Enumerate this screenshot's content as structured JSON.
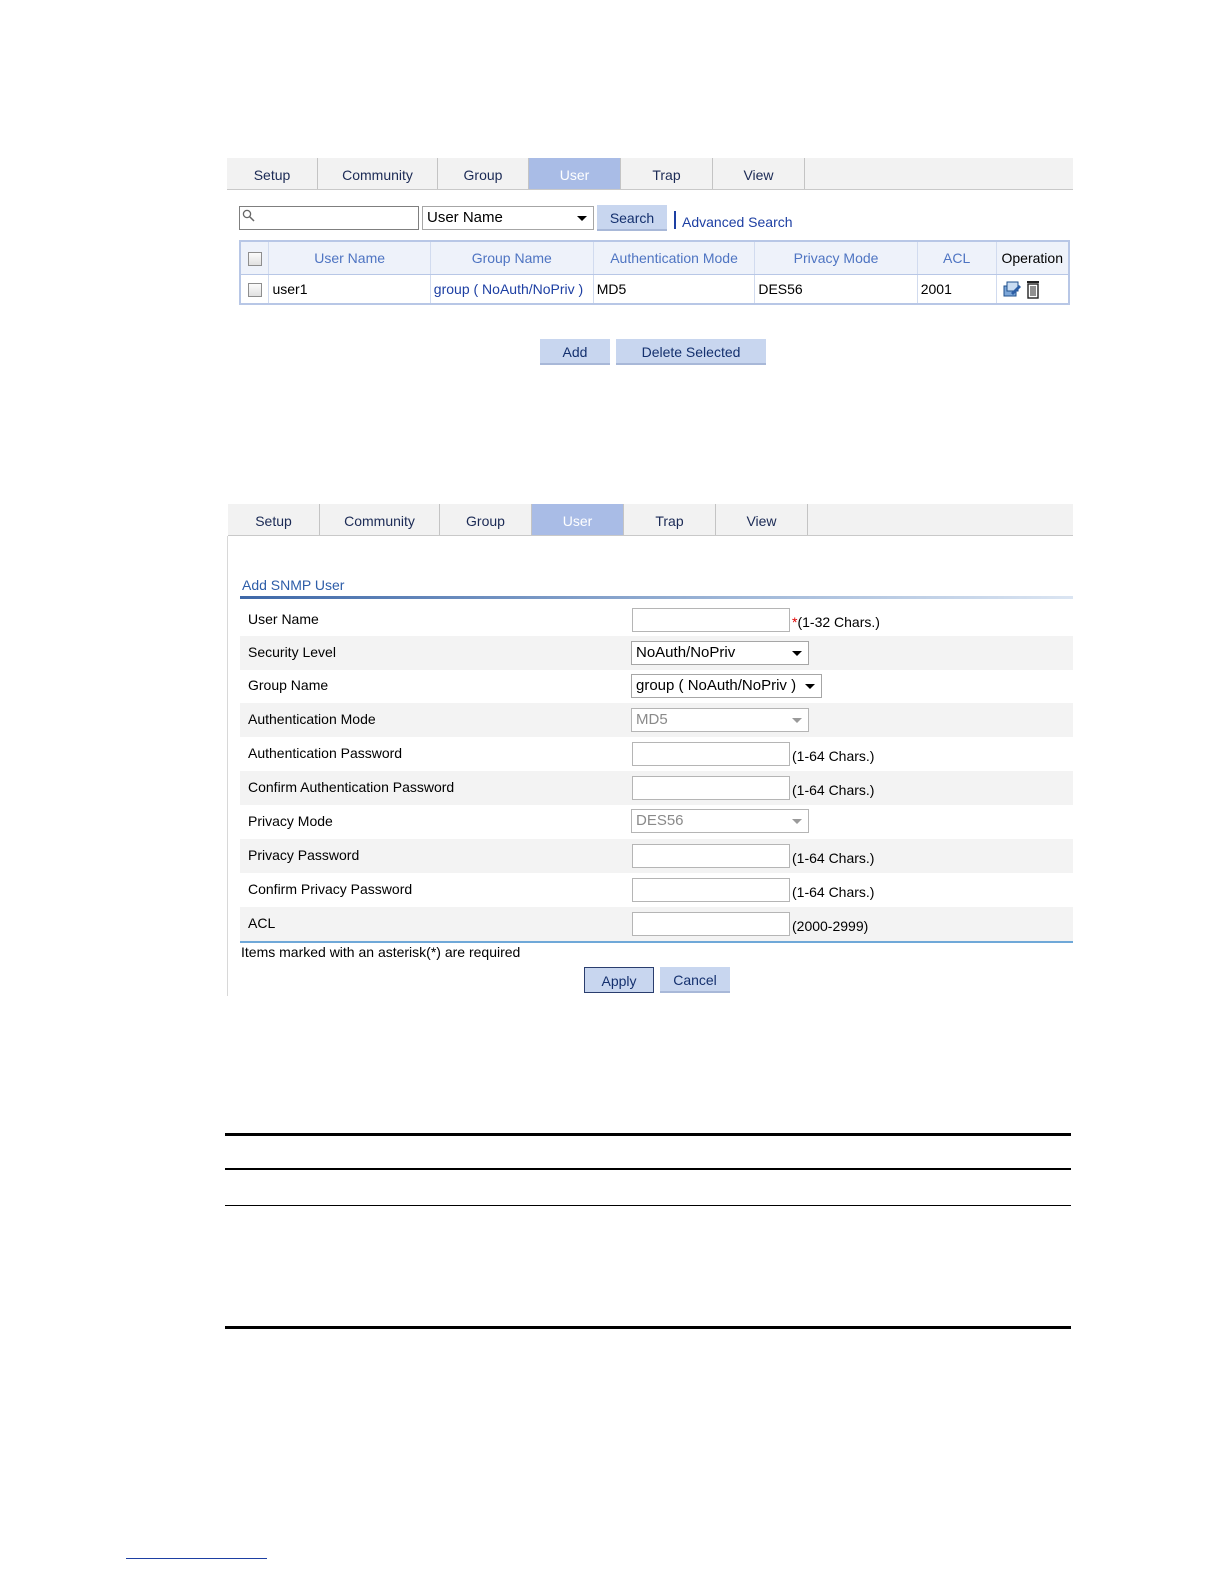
{
  "tabs": [
    "Setup",
    "Community",
    "Group",
    "User",
    "Trap",
    "View"
  ],
  "active_tab": "User",
  "list_panel": {
    "search": {
      "value": "",
      "field_select": "User Name",
      "button": "Search",
      "advanced_link": "Advanced Search"
    },
    "columns": [
      "User Name",
      "Group Name",
      "Authentication Mode",
      "Privacy Mode",
      "ACL",
      "Operation"
    ],
    "rows": [
      {
        "user_name": "user1",
        "group_name": "group ( NoAuth/NoPriv )",
        "auth_mode": "MD5",
        "privacy_mode": "DES56",
        "acl": "2001"
      }
    ],
    "buttons": {
      "add": "Add",
      "delete_selected": "Delete Selected"
    }
  },
  "form_panel": {
    "title": "Add SNMP User",
    "fields": {
      "user_name": {
        "label": "User Name",
        "value": "",
        "asterisk": "*",
        "hint": "(1-32 Chars.)"
      },
      "security_level": {
        "label": "Security Level",
        "value": "NoAuth/NoPriv"
      },
      "group_name": {
        "label": "Group Name",
        "value": "group ( NoAuth/NoPriv )"
      },
      "auth_mode": {
        "label": "Authentication Mode",
        "value": "MD5",
        "disabled": true
      },
      "auth_password": {
        "label": "Authentication Password",
        "value": "",
        "hint": "(1-64 Chars.)"
      },
      "confirm_auth_password": {
        "label": "Confirm Authentication Password",
        "value": "",
        "hint": "(1-64 Chars.)"
      },
      "privacy_mode": {
        "label": "Privacy Mode",
        "value": "DES56",
        "disabled": true
      },
      "privacy_password": {
        "label": "Privacy Password",
        "value": "",
        "hint": "(1-64 Chars.)"
      },
      "confirm_privacy_password": {
        "label": "Confirm Privacy Password",
        "value": "",
        "hint": "(1-64 Chars.)"
      },
      "acl": {
        "label": "ACL",
        "value": "",
        "hint": "(2000-2999)"
      }
    },
    "required_note": "Items marked with an asterisk(*) are required",
    "buttons": {
      "apply": "Apply",
      "cancel": "Cancel"
    }
  },
  "colors": {
    "active_tab": "#a9bce6",
    "link": "#1d3fa3",
    "button_bg": "#c8d6ef",
    "required_asterisk": "#e00000"
  }
}
